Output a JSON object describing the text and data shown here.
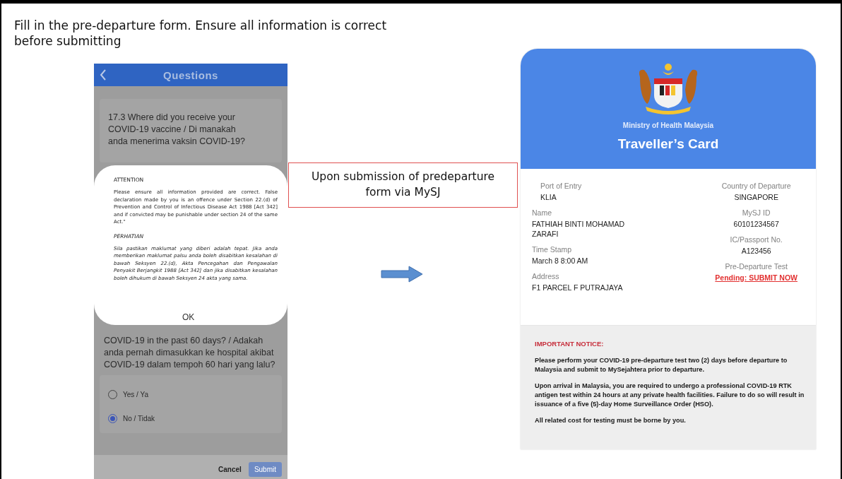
{
  "instruction": "Fill in the pre-departure form. Ensure all information is correct before submitting",
  "form_screen": {
    "title": "Questions",
    "question": "17.3  Where did you receive your COVID-19 vaccine / Di manakah anda menerima vaksin COVID-19?",
    "modal": {
      "heading": "ATTENTION",
      "body": "Please ensure all information provided are correct. False declaration made by you is an offence under Section 22.(d) of Prevention and Control of Infectious Disease Act 1988 [Act 342] and if convicted may be punishable under section 24 of the same Act.\"",
      "heading_ms": "PERHATIAN",
      "body_ms": "Sila pastikan maklumat yang diberi adalah tepat. Jika anda memberikan maklumat palsu anda boleh disabitkan kesalahan di bawah Seksyen 22.(d), Akta Pencegahan dan Pengawalan Penyakit Berjangkit 1988 [Act 342] dan jika disabitkan kesalahan boleh dihukum di bawah Seksyen 24 akta yang sama.",
      "button": "OK"
    },
    "question_2": "COVID-19 in the past 60 days? / Adakah anda pernah dimasukkan ke hospital akibat COVID-19 dalam tempoh 60 hari yang lalu?",
    "options": [
      {
        "label": "Yes / Ya",
        "selected": false
      },
      {
        "label": "No / Tidak",
        "selected": true
      }
    ],
    "cancel": "Cancel",
    "submit": {
      "label": "Submit",
      "disabled": true
    }
  },
  "callout": "Upon submission of predeparture form via MySJ",
  "card": {
    "ministry": "Ministry of Health Malaysia",
    "title": "Traveller’s Card",
    "left_fields": [
      {
        "label": "Port of Entry",
        "value": "KLIA",
        "kind": "plain"
      },
      {
        "label": "Name",
        "value": "FATHIAH BINTI MOHAMAD ZARAFI",
        "kind": "plain"
      },
      {
        "label": "Time Stamp",
        "value": "March 8  8:00 AM",
        "kind": "plain"
      },
      {
        "label": "Address",
        "value": "F1 PARCEL F PUTRAJAYA",
        "kind": "plain"
      }
    ],
    "right_fields": [
      {
        "label": "Country of Departure",
        "value": "SINGAPORE",
        "kind": "plain"
      },
      {
        "label": "MySJ ID",
        "value": "60101234567",
        "kind": "plain"
      },
      {
        "label": "IC/Passport No.",
        "value": "A123456",
        "kind": "plain"
      },
      {
        "label": "Pre-Departure Test",
        "value": "Pending: SUBMIT NOW",
        "kind": "alert"
      }
    ],
    "notice": {
      "heading": "IMPORTANT NOTICE:",
      "paragraphs": [
        "Please perform your COVID-19 pre-departure test two (2) days before departure to Malaysia and submit to MySejahtera prior to departure.",
        "Upon arrival in Malaysia, you are required to undergo a professional COVID-19 RTK antigen test within 24 hours at any private health facilities. Failure to do so will result in issuance of a five (5)-day Home Surveillance Order (HSO).",
        "All related cost for testing must be borne by you."
      ]
    }
  }
}
